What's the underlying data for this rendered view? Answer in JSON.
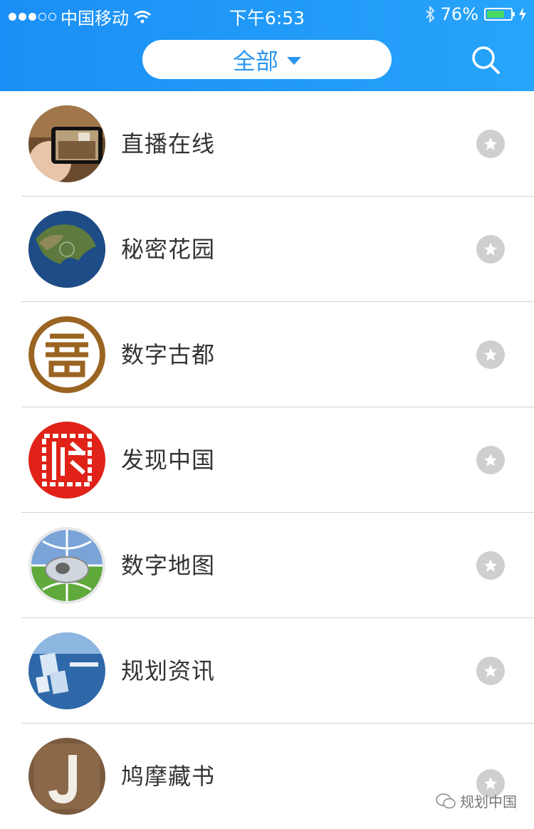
{
  "status_bar": {
    "carrier": "中国移动",
    "time": "下午6:53",
    "battery": "76%",
    "battery_level": 0.76
  },
  "header": {
    "filter_label": "全部"
  },
  "items": [
    {
      "label": "直播在线"
    },
    {
      "label": "秘密花园"
    },
    {
      "label": "数字古都"
    },
    {
      "label": "发现中国"
    },
    {
      "label": "数字地图"
    },
    {
      "label": "规划资讯"
    },
    {
      "label": "鸠摩藏书"
    }
  ],
  "watermark": {
    "text": "规划中国"
  },
  "colors": {
    "header": "#1a8ff5",
    "accent": "#2a95ee",
    "star_bg": "#cfcfcf"
  }
}
